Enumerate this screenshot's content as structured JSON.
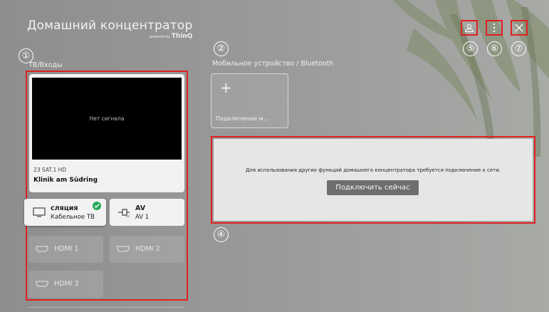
{
  "header": {
    "title": "Домашний концентратор",
    "powered_prefix": "powered by",
    "powered_brand": "ThinQ"
  },
  "callouts": [
    "①",
    "②",
    "④",
    "⑤",
    "⑥",
    "⑦"
  ],
  "tv_inputs": {
    "label": "ТВ/Входы",
    "preview": {
      "no_signal": "Нет сигнала",
      "channel": "23 SAT.1 HD",
      "program": "Klinik am Südring"
    },
    "sources": [
      {
        "name": "сляция",
        "sub": "Кабельное ТВ",
        "icon": "tv-icon",
        "selected": true
      },
      {
        "name": "AV",
        "sub": "AV 1",
        "icon": "av-input-icon",
        "selected": false
      },
      {
        "name": "HDMI 1",
        "icon": "hdmi-icon",
        "disabled": true
      },
      {
        "name": "HDMI 2",
        "icon": "hdmi-icon",
        "disabled": true
      },
      {
        "name": "HDMI 3",
        "icon": "hdmi-icon",
        "disabled": true
      }
    ]
  },
  "mobile": {
    "label": "Мобильное устройство / Bluetooth",
    "add_label": "Подключение м..."
  },
  "network": {
    "message": "Для использования других функций домашнего концентратора требуется подключение к сети.",
    "button": "Подключить сейчас"
  },
  "top_icons": [
    "profile-icon",
    "more-options-icon",
    "close-icon"
  ],
  "colors": {
    "annotation_red": "#e02020",
    "selected_check": "#25a85a"
  }
}
